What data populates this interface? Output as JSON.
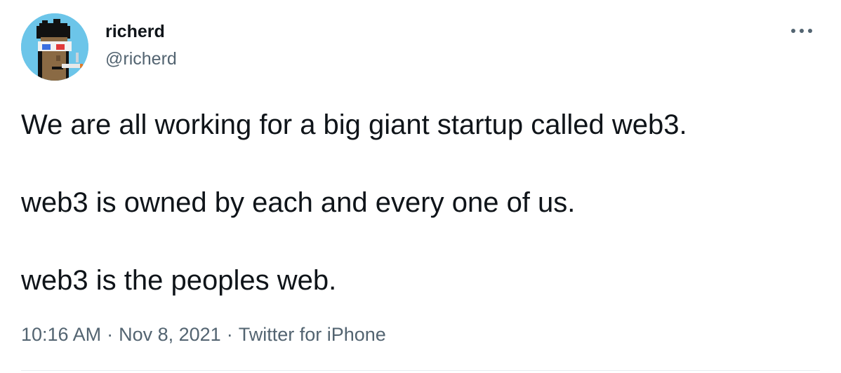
{
  "author": {
    "display_name": "richerd",
    "handle": "@richerd"
  },
  "tweet": {
    "paragraphs": [
      "We are all working for a big giant startup called web3.",
      "web3 is owned by each and every one of us.",
      "web3 is the peoples web."
    ],
    "time": "10:16 AM",
    "date": "Nov 8, 2021",
    "source": "Twitter for iPhone",
    "separator": "·"
  },
  "icons": {
    "more": "more-options-icon",
    "avatar": "punk-avatar"
  },
  "colors": {
    "text": "#0f1419",
    "secondary": "#536471",
    "avatar_bg": "#6cc5e9"
  }
}
